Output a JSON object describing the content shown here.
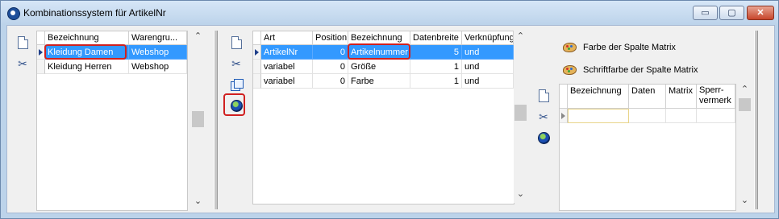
{
  "window": {
    "title": "Kombinationssystem für ArtikelNr",
    "minimize_glyph": "▭",
    "maximize_glyph": "▢",
    "close_glyph": "✕"
  },
  "left_grid": {
    "columns": [
      "Bezeichnung",
      "Warengru..."
    ],
    "rows": [
      {
        "bezeichnung": "Kleidung Damen",
        "warengruppe": "Webshop",
        "selected": true
      },
      {
        "bezeichnung": "Kleidung Herren",
        "warengruppe": "Webshop",
        "selected": false
      }
    ]
  },
  "middle_grid": {
    "columns": [
      "Art",
      "Position",
      "Bezeichnung",
      "Datenbreite",
      "Verknüpfung"
    ],
    "rows": [
      {
        "art": "ArtikelNr",
        "position": "0",
        "bezeichnung": "Artikelnummer",
        "datenbreite": "5",
        "verknuepfung": "und",
        "selected": true
      },
      {
        "art": "variabel",
        "position": "0",
        "bezeichnung": "Größe",
        "datenbreite": "1",
        "verknuepfung": "und",
        "selected": false
      },
      {
        "art": "variabel",
        "position": "0",
        "bezeichnung": "Farbe",
        "datenbreite": "1",
        "verknuepfung": "und",
        "selected": false
      }
    ]
  },
  "right_panel": {
    "color_matrix_label": "Farbe der Spalte Matrix",
    "font_color_matrix_label": "Schriftfarbe der Spalte Matrix",
    "columns": [
      "Bezeichnung",
      "Daten",
      "Matrix",
      "Sperr-",
      "vermerk"
    ]
  },
  "scroll": {
    "up": "⌃",
    "down": "⌄"
  },
  "icons": {
    "new": "document-icon",
    "cut": "scissors-icon",
    "copy": "copy-icon",
    "globe": "globe-icon",
    "palette": "palette-icon"
  }
}
